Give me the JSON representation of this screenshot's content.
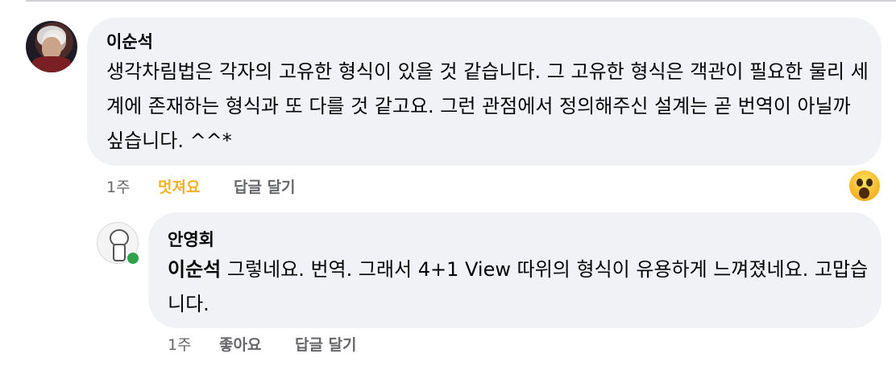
{
  "comment": {
    "author": "이순석",
    "text": "생각차림법은 각자의 고유한 형식이 있을 것 같습니다. 그 고유한 형식은 객관이 필요한 물리 세계에 존재하는 형식과 또 다를 것 같고요. 그런 관점에서 정의해주신 설계는 곧 번역이 아닐까 싶습니다. ^^*",
    "time": "1주",
    "reaction_label": "멋져요",
    "reply_label": "답글 달기",
    "reaction_icon": "wow-emoji-icon"
  },
  "reply": {
    "author": "안영회",
    "mention": "이순석",
    "text": "그렇네요. 번역. 그래서 4+1 View 따위의 형식이 유용하게 느껴졌네요. 고맙습니다.",
    "time": "1주",
    "like_label": "좋아요",
    "reply_label": "답글 달기"
  },
  "colors": {
    "bubble": "#f0f2f5",
    "meta_text": "#65676b",
    "reaction_accent": "#f7b125",
    "online": "#31a24c"
  }
}
